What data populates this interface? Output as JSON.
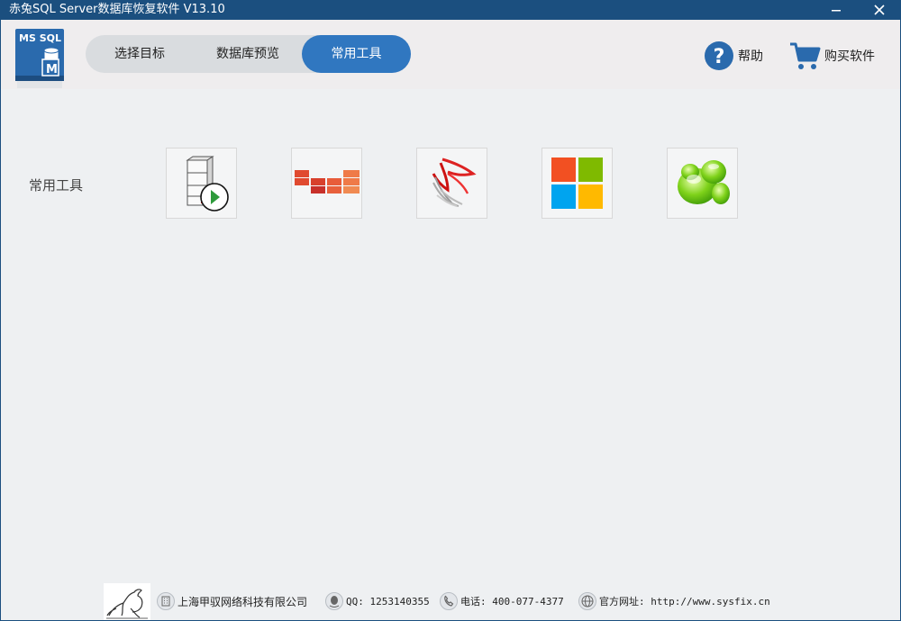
{
  "window": {
    "title": "赤兔SQL Server数据库恢复软件 V13.10"
  },
  "logo": {
    "line1": "MS SQL",
    "badge": "M"
  },
  "tabs": [
    {
      "label": "选择目标",
      "active": false
    },
    {
      "label": "数据库预览",
      "active": false
    },
    {
      "label": "常用工具",
      "active": true
    }
  ],
  "header_actions": {
    "help_label": "帮助",
    "buy_label": "购买软件"
  },
  "tools_section": {
    "label": "常用工具",
    "items": [
      {
        "icon": "server-play-icon"
      },
      {
        "icon": "red-bricks-icon"
      },
      {
        "icon": "sql-server-icon"
      },
      {
        "icon": "windows-logo-icon"
      },
      {
        "icon": "green-app-icon"
      }
    ]
  },
  "footer": {
    "company": "上海甲驭网络科技有限公司",
    "qq": "QQ: 1253140355",
    "phone": "电话: 400-077-4377",
    "website": "官方网址: http://www.sysfix.cn"
  },
  "colors": {
    "titlebar": "#1b4f7f",
    "accent": "#3077c0",
    "background": "#eef0f2"
  }
}
